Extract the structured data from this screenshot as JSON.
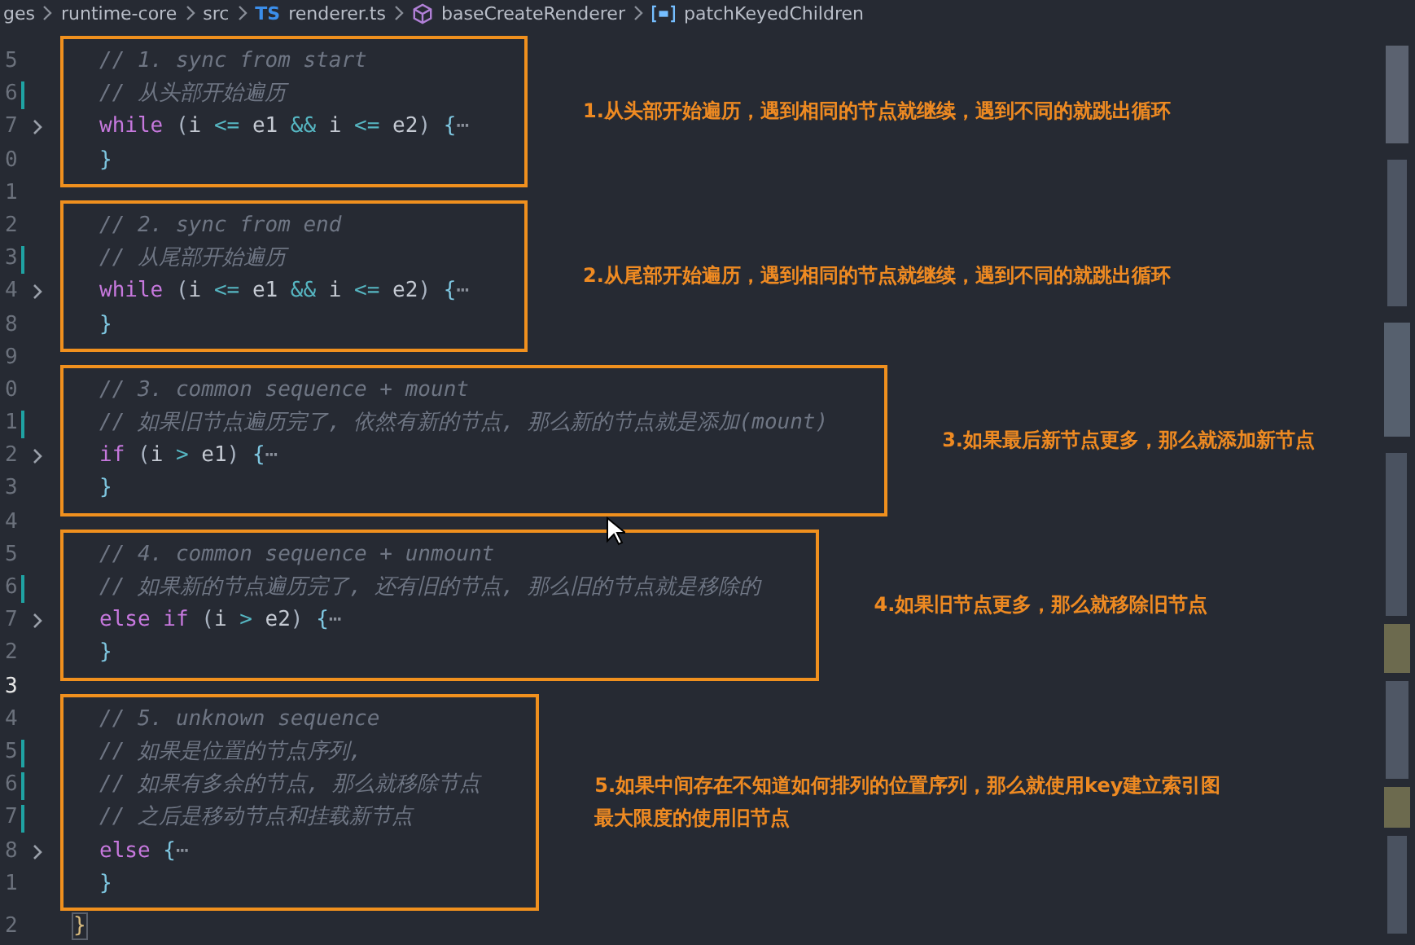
{
  "breadcrumb": [
    {
      "kind": "folder",
      "label": "ges"
    },
    {
      "kind": "folder",
      "label": "runtime-core"
    },
    {
      "kind": "folder",
      "label": "src"
    },
    {
      "kind": "ts-file",
      "icon_text": "TS",
      "label": "renderer.ts"
    },
    {
      "kind": "method",
      "label": "baseCreateRenderer"
    },
    {
      "kind": "variable",
      "label": "patchKeyedChildren"
    }
  ],
  "blocks": [
    {
      "kind": "section",
      "note": [
        "1.从头部开始遍历，遇到相同的节点就继续，遇到不同的就跳出循环"
      ],
      "lines": [
        {
          "number": "5",
          "fold": false,
          "modified": false,
          "current": false,
          "tokens": [
            {
              "kind": "comment",
              "text": "// 1. sync from start"
            }
          ]
        },
        {
          "number": "6",
          "fold": false,
          "modified": true,
          "current": false,
          "tokens": [
            {
              "kind": "comment",
              "text": "// 从头部开始遍历"
            }
          ]
        },
        {
          "number": "7",
          "fold": true,
          "modified": false,
          "current": false,
          "tokens": [
            {
              "kind": "keyword",
              "text": "while"
            },
            {
              "kind": "punct",
              "text": " ("
            },
            {
              "kind": "ident",
              "text": "i"
            },
            {
              "kind": "operator",
              "text": " <= "
            },
            {
              "kind": "ident",
              "text": "e1"
            },
            {
              "kind": "operator",
              "text": " && "
            },
            {
              "kind": "ident",
              "text": "i"
            },
            {
              "kind": "operator",
              "text": " <= "
            },
            {
              "kind": "ident",
              "text": "e2"
            },
            {
              "kind": "punct",
              "text": ") "
            },
            {
              "kind": "brace",
              "text": "{"
            },
            {
              "kind": "ellipsis",
              "text": "⋯"
            }
          ]
        },
        {
          "number": "0",
          "fold": false,
          "modified": false,
          "current": false,
          "tokens": [
            {
              "kind": "brace",
              "text": "}"
            }
          ]
        }
      ]
    },
    {
      "kind": "line",
      "line": {
        "number": "1",
        "fold": false,
        "modified": false,
        "current": false
      }
    },
    {
      "kind": "section",
      "note": [
        "2.从尾部开始遍历，遇到相同的节点就继续，遇到不同的就跳出循环"
      ],
      "lines": [
        {
          "number": "2",
          "fold": false,
          "modified": false,
          "current": false,
          "tokens": [
            {
              "kind": "comment",
              "text": "// 2. sync from end"
            }
          ]
        },
        {
          "number": "3",
          "fold": false,
          "modified": true,
          "current": false,
          "tokens": [
            {
              "kind": "comment",
              "text": "// 从尾部开始遍历"
            }
          ]
        },
        {
          "number": "4",
          "fold": true,
          "modified": false,
          "current": false,
          "tokens": [
            {
              "kind": "keyword",
              "text": "while"
            },
            {
              "kind": "punct",
              "text": " ("
            },
            {
              "kind": "ident",
              "text": "i"
            },
            {
              "kind": "operator",
              "text": " <= "
            },
            {
              "kind": "ident",
              "text": "e1"
            },
            {
              "kind": "operator",
              "text": " && "
            },
            {
              "kind": "ident",
              "text": "i"
            },
            {
              "kind": "operator",
              "text": " <= "
            },
            {
              "kind": "ident",
              "text": "e2"
            },
            {
              "kind": "punct",
              "text": ") "
            },
            {
              "kind": "brace",
              "text": "{"
            },
            {
              "kind": "ellipsis",
              "text": "⋯"
            }
          ]
        },
        {
          "number": "8",
          "fold": false,
          "modified": false,
          "current": false,
          "tokens": [
            {
              "kind": "brace",
              "text": "}"
            }
          ]
        }
      ]
    },
    {
      "kind": "line",
      "line": {
        "number": "9",
        "fold": false,
        "modified": false,
        "current": false
      }
    },
    {
      "kind": "section",
      "note": [
        "3.如果最后新节点更多，那么就添加新节点"
      ],
      "lines": [
        {
          "number": "0",
          "fold": false,
          "modified": false,
          "current": false,
          "tokens": [
            {
              "kind": "comment",
              "text": "// 3. common sequence + mount"
            }
          ]
        },
        {
          "number": "1",
          "fold": false,
          "modified": true,
          "current": false,
          "tokens": [
            {
              "kind": "comment",
              "text": "// 如果旧节点遍历完了, 依然有新的节点, 那么新的节点就是添加(mount)"
            }
          ]
        },
        {
          "number": "2",
          "fold": true,
          "modified": false,
          "current": false,
          "tokens": [
            {
              "kind": "keyword",
              "text": "if"
            },
            {
              "kind": "punct",
              "text": " ("
            },
            {
              "kind": "ident",
              "text": "i"
            },
            {
              "kind": "operator",
              "text": " > "
            },
            {
              "kind": "ident",
              "text": "e1"
            },
            {
              "kind": "punct",
              "text": ") "
            },
            {
              "kind": "brace",
              "text": "{"
            },
            {
              "kind": "ellipsis",
              "text": "⋯"
            }
          ]
        },
        {
          "number": "3",
          "fold": false,
          "modified": false,
          "current": false,
          "tokens": [
            {
              "kind": "brace",
              "text": "}"
            }
          ]
        }
      ]
    },
    {
      "kind": "line",
      "line": {
        "number": "4",
        "fold": false,
        "modified": false,
        "current": false
      }
    },
    {
      "kind": "section",
      "note": [
        "4.如果旧节点更多，那么就移除旧节点"
      ],
      "lines": [
        {
          "number": "5",
          "fold": false,
          "modified": false,
          "current": false,
          "tokens": [
            {
              "kind": "comment",
              "text": "// 4. common sequence + unmount"
            }
          ]
        },
        {
          "number": "6",
          "fold": false,
          "modified": true,
          "current": false,
          "tokens": [
            {
              "kind": "comment",
              "text": "// 如果新的节点遍历完了, 还有旧的节点, 那么旧的节点就是移除的"
            }
          ]
        },
        {
          "number": "7",
          "fold": true,
          "modified": false,
          "current": false,
          "tokens": [
            {
              "kind": "keyword",
              "text": "else if"
            },
            {
              "kind": "punct",
              "text": " ("
            },
            {
              "kind": "ident",
              "text": "i"
            },
            {
              "kind": "operator",
              "text": " > "
            },
            {
              "kind": "ident",
              "text": "e2"
            },
            {
              "kind": "punct",
              "text": ") "
            },
            {
              "kind": "brace",
              "text": "{"
            },
            {
              "kind": "ellipsis",
              "text": "⋯"
            }
          ]
        },
        {
          "number": "2",
          "fold": false,
          "modified": false,
          "current": false,
          "tokens": [
            {
              "kind": "brace",
              "text": "}"
            }
          ]
        }
      ]
    },
    {
      "kind": "line",
      "line": {
        "number": "3",
        "fold": false,
        "modified": false,
        "current": true
      }
    },
    {
      "kind": "section",
      "note": [
        "5.如果中间存在不知道如何排列的位置序列，那么就使用key建立索引图",
        "最大限度的使用旧节点"
      ],
      "lines": [
        {
          "number": "4",
          "fold": false,
          "modified": false,
          "current": false,
          "tokens": [
            {
              "kind": "comment",
              "text": "// 5. unknown sequence"
            }
          ]
        },
        {
          "number": "5",
          "fold": false,
          "modified": true,
          "current": false,
          "tokens": [
            {
              "kind": "comment",
              "text": "// 如果是位置的节点序列,"
            }
          ]
        },
        {
          "number": "6",
          "fold": false,
          "modified": true,
          "current": false,
          "tokens": [
            {
              "kind": "comment",
              "text": "// 如果有多余的节点, 那么就移除节点"
            }
          ]
        },
        {
          "number": "7",
          "fold": false,
          "modified": true,
          "current": false,
          "tokens": [
            {
              "kind": "comment",
              "text": "// 之后是移动节点和挂载新节点"
            }
          ]
        },
        {
          "number": "8",
          "fold": true,
          "modified": false,
          "current": false,
          "tokens": [
            {
              "kind": "keyword",
              "text": "else"
            },
            {
              "kind": "brace",
              "text": "{"
            },
            {
              "kind": "ellipsis",
              "text": "⋯"
            }
          ]
        },
        {
          "number": "1",
          "fold": false,
          "modified": false,
          "current": false,
          "tokens": [
            {
              "kind": "brace",
              "text": "}"
            }
          ]
        }
      ]
    },
    {
      "kind": "line",
      "line": {
        "number": "2",
        "fold": false,
        "modified": false,
        "current": false,
        "tokens": [
          {
            "kind": "outer-brace",
            "text": "}"
          }
        ]
      }
    }
  ]
}
